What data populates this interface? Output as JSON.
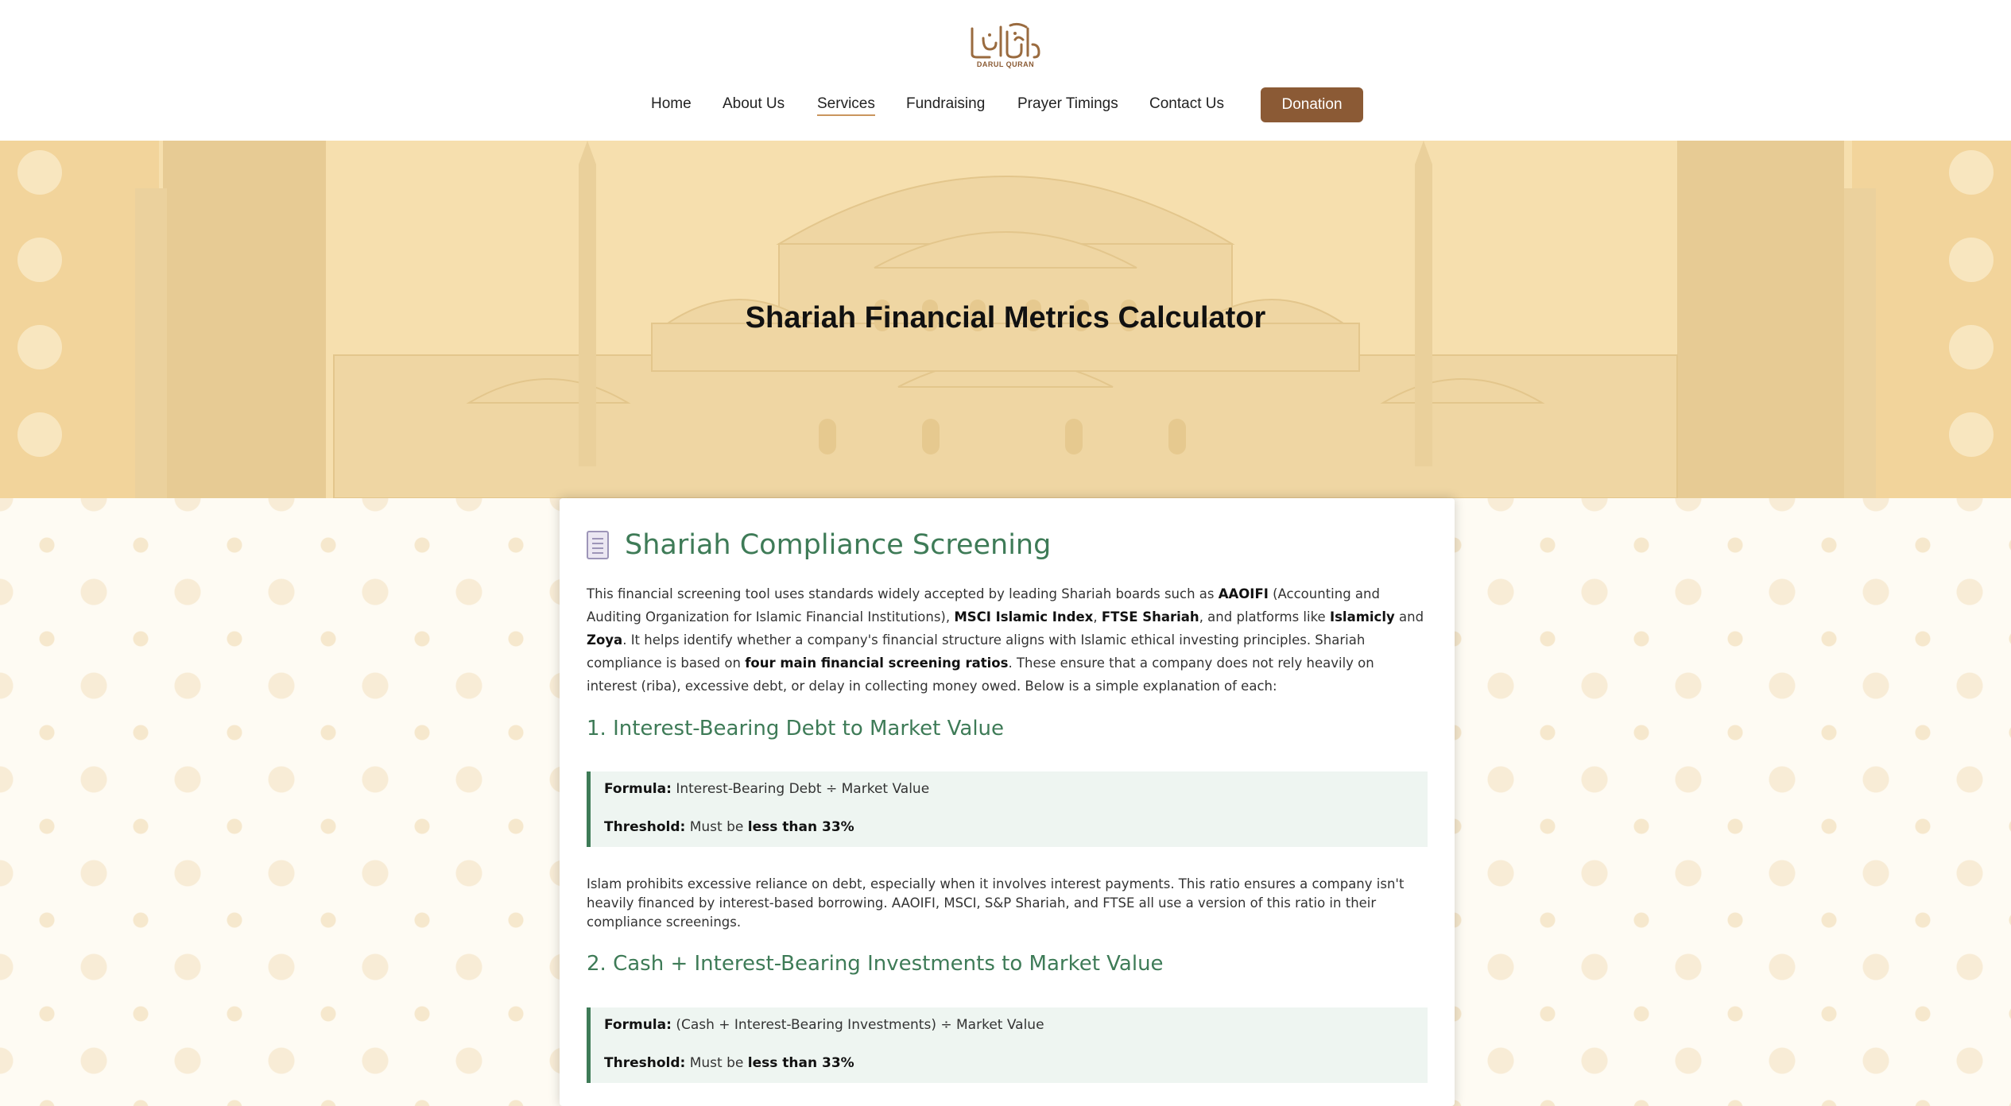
{
  "brand": {
    "logo_text": "DARUL QURAN",
    "accent": "#8b5a35"
  },
  "nav": {
    "items": [
      {
        "label": "Home"
      },
      {
        "label": "About Us"
      },
      {
        "label": "Services",
        "active": true
      },
      {
        "label": "Fundraising"
      },
      {
        "label": "Prayer Timings"
      },
      {
        "label": "Contact Us"
      }
    ],
    "donate_label": "Donation"
  },
  "hero": {
    "title": "Shariah Financial Metrics Calculator"
  },
  "content": {
    "title_icon": "document-icon",
    "title": "Shariah Compliance Screening",
    "intro": [
      {
        "t": "This financial screening tool uses standards widely accepted by leading Shariah boards such as "
      },
      {
        "b": "AAOIFI"
      },
      {
        "t": " (Accounting and Auditing Organization for Islamic Financial Institutions), "
      },
      {
        "b": "MSCI Islamic Index"
      },
      {
        "t": ", "
      },
      {
        "b": "FTSE Shariah"
      },
      {
        "t": ", and platforms like "
      },
      {
        "b": "Islamicly"
      },
      {
        "t": " and "
      },
      {
        "b": "Zoya"
      },
      {
        "t": ". It helps identify whether a company's financial structure aligns with Islamic ethical investing principles. Shariah compliance is based on "
      },
      {
        "b": "four main financial screening ratios"
      },
      {
        "t": ". These ensure that a company does not rely heavily on interest (riba), excessive debt, or delay in collecting money owed. Below is a simple explanation of each:"
      }
    ],
    "sections": [
      {
        "heading": "1. Interest-Bearing Debt to Market Value",
        "formula_label": "Formula:",
        "formula": "Interest-Bearing Debt ÷ Market Value",
        "threshold_label": "Threshold:",
        "threshold_prefix": "Must be",
        "threshold_value": "less than 33%",
        "explanation": "Islam prohibits excessive reliance on debt, especially when it involves interest payments. This ratio ensures a company isn't heavily financed by interest-based borrowing. AAOIFI, MSCI, S&P Shariah, and FTSE all use a version of this ratio in their compliance screenings."
      },
      {
        "heading": "2. Cash + Interest-Bearing Investments to Market Value",
        "formula_label": "Formula:",
        "formula": "(Cash + Interest-Bearing Investments) ÷ Market Value",
        "threshold_label": "Threshold:",
        "threshold_prefix": "Must be",
        "threshold_value": "less than 33%"
      }
    ]
  }
}
